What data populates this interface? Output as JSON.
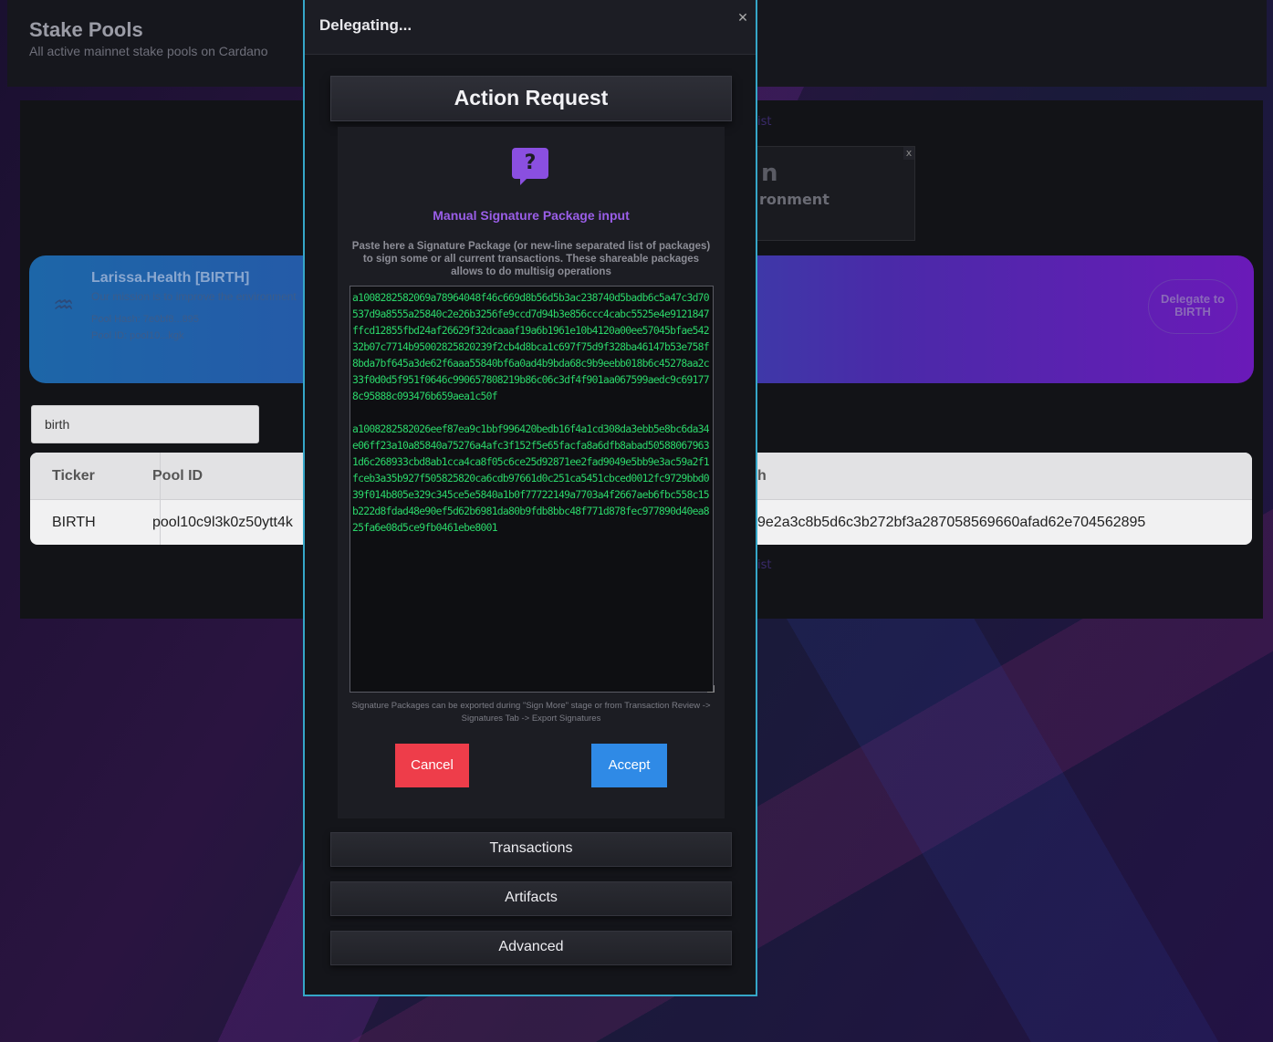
{
  "page": {
    "title": "Stake Pools",
    "subtitle": "All active mainnet stake pools on Cardano"
  },
  "pool_card": {
    "name": "Larissa.Health [BIRTH]",
    "description": "Our mission is to improve the environment",
    "hash": "Pool Hash: 7e0bf8...895",
    "id": "Pool ID: pool10...kgk",
    "delegate_label": "Delegate to BIRTH",
    "icon": "pool-swim-icon"
  },
  "ghost": {
    "list_top": "ist",
    "list_bottom": "ist",
    "toast_title": "n",
    "toast_text": "ronment",
    "toast_close": "x"
  },
  "search": {
    "value": "birth"
  },
  "table": {
    "headers": [
      "Ticker",
      "Pool ID",
      "h"
    ],
    "rows": [
      [
        "BIRTH",
        "pool10c9l3k0z50ytt4k",
        "9e2a3c8b5d6c3b272bf3a287058569660afad62e704562895"
      ]
    ]
  },
  "modal": {
    "title": "Delegating...",
    "close": "✕",
    "action_title": "Action Request",
    "icon": "question-bubble-icon",
    "sig_title": "Manual Signature Package input",
    "sig_help": "Paste here a Signature Package (or new-line separated list of packages) to sign some or all current transactions. These shareable packages allows to do multisig operations",
    "sig_value": "a1008282582069a78964048f46c669d8b56d5b3ac238740d5badb6c5a47c3d70537d9a8555a25840c2e26b3256fe9ccd7d94b3e856ccc4cabc5525e4e9121847ffcd12855fbd24af26629f32dcaaaf19a6b1961e10b4120a00ee57045bfae54232b07c7714b95002825820239f2cb4d8bca1c697f75d9f328ba46147b53e758f8bda7bf645a3de62f6aaa55840bf6a0ad4b9bda68c9b9eebb018b6c45278aa2c33f0d0d5f951f0646c990657808219b86c06c3df4f901aa067599aedc9c691778c95888c093476b659aea1c50f\n\na1008282582026eef87ea9c1bbf996420bedb16f4a1cd308da3ebb5e8bc6da34e06ff23a10a85840a75276a4afc3f152f5e65facfa8a6dfb8abad505880679631d6c268933cbd8ab1cca4ca8f05c6ce25d92871ee2fad9049e5bb9e3ac59a2f1fceb3a35b927f505825820ca6cdb97661d0c251ca5451cbced0012fc9729bbd039f014b805e329c345ce5e5840a1b0f77722149a7703a4f2667aeb6fbc558c15b222d8fdad48e90ef5d62b6981da80b9fdb8bbc48f771d878fec977890d40ea825fa6e08d5ce9fb0461ebe8001",
    "sig_note": "Signature Packages can be exported during \"Sign More\" stage or from Transaction Review -> Signatures Tab -> Export Signatures",
    "cancel_label": "Cancel",
    "accept_label": "Accept",
    "sections": [
      "Transactions",
      "Artifacts",
      "Advanced"
    ]
  },
  "colors": {
    "modal_border": "#35a6c8",
    "accent_purple": "#9a5ee8",
    "cancel": "#ee3d4a",
    "accept": "#2f8ae6",
    "signature_text": "#2bd66a"
  }
}
